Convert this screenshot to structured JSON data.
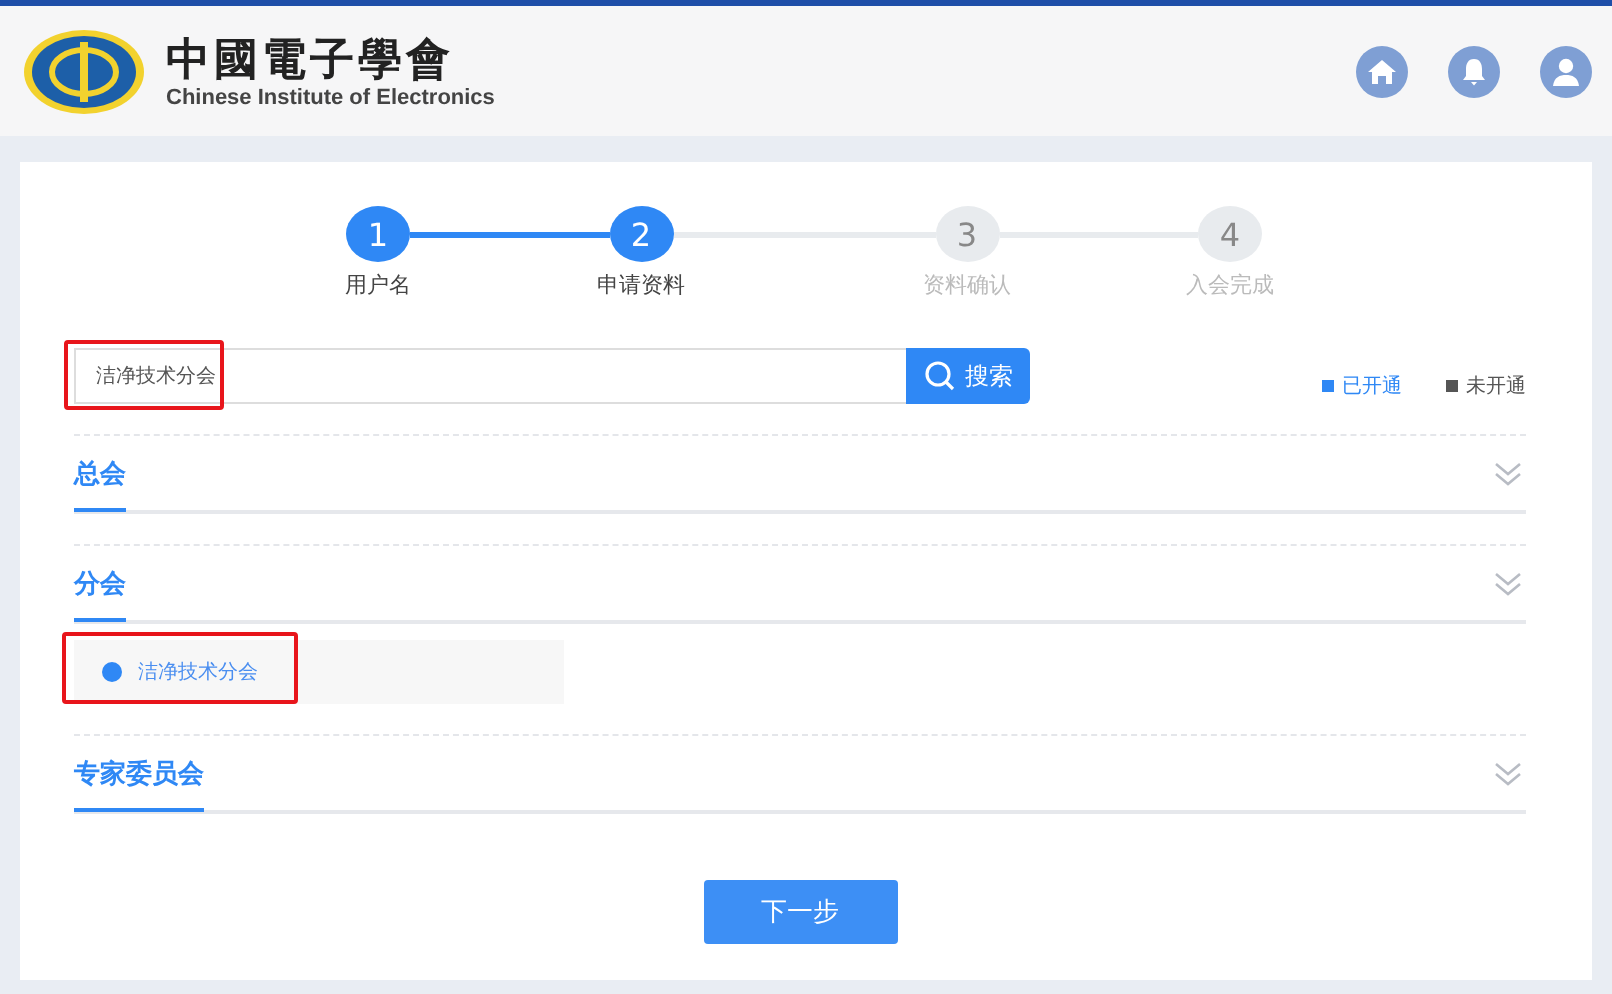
{
  "header": {
    "logo_title": "中國電子學會",
    "logo_subtitle": "Chinese Institute of Electronics"
  },
  "steps": [
    {
      "number": "1",
      "label": "用户名",
      "completed": true
    },
    {
      "number": "2",
      "label": "申请资料",
      "completed": true
    },
    {
      "number": "3",
      "label": "资料确认",
      "completed": false
    },
    {
      "number": "4",
      "label": "入会完成",
      "completed": false
    }
  ],
  "search": {
    "value": "洁净技术分会",
    "highlighted": true,
    "button": "搜索"
  },
  "legend": [
    {
      "label": "已开通",
      "color": "#2f88f5"
    },
    {
      "label": "未开通",
      "color": "#555555"
    }
  ],
  "sections": [
    {
      "title": "总会"
    },
    {
      "title": "分会",
      "items": [
        {
          "name": "洁净技术分会",
          "color": "#2f88f5",
          "highlighted": true
        }
      ]
    },
    {
      "title": "专家委员会"
    }
  ],
  "next_button": "下一步"
}
